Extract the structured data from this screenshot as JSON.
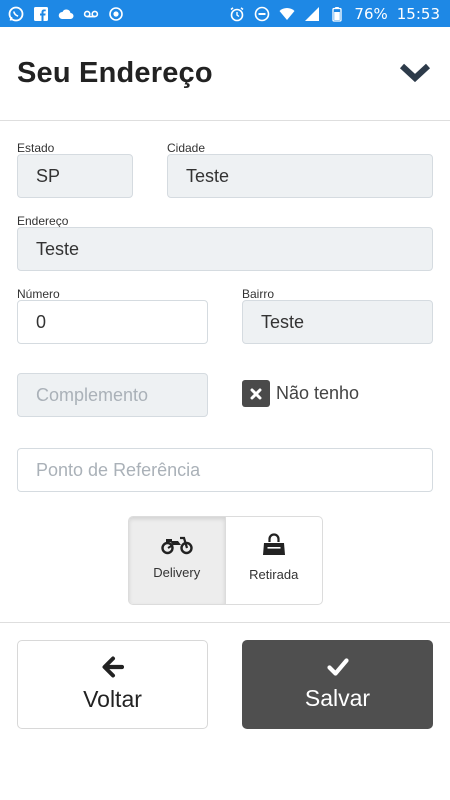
{
  "status_bar": {
    "battery": "76%",
    "time": "15:53",
    "left_icons": [
      "whatsapp-icon",
      "facebook-icon",
      "cloud-icon",
      "voicemail-icon",
      "record-icon"
    ],
    "right_icons": [
      "alarm-icon",
      "do-not-disturb-icon",
      "wifi-icon",
      "signal-icon",
      "battery-icon"
    ]
  },
  "header": {
    "title": "Seu Endereço",
    "collapse_icon": "chevron-down-icon"
  },
  "form": {
    "estado": {
      "label": "Estado",
      "value": "SP"
    },
    "cidade": {
      "label": "Cidade",
      "value": "Teste"
    },
    "endereco": {
      "label": "Endereço",
      "value": "Teste"
    },
    "numero": {
      "label": "Número",
      "value": "0"
    },
    "bairro": {
      "label": "Bairro",
      "value": "Teste"
    },
    "complemento": {
      "placeholder": "Complemento"
    },
    "nao_tenho": {
      "label": "Não tenho",
      "checked": true
    },
    "referencia": {
      "placeholder": "Ponto de Referência"
    }
  },
  "delivery_options": [
    {
      "label": "Delivery",
      "icon": "motorcycle-icon",
      "selected": true
    },
    {
      "label": "Retirada",
      "icon": "shopping-bag-icon",
      "selected": false
    }
  ],
  "actions": {
    "back": {
      "label": "Voltar",
      "icon": "arrow-left-icon"
    },
    "save": {
      "label": "Salvar",
      "icon": "check-icon"
    }
  },
  "colors": {
    "status_bar": "#1e88e5",
    "field_bg": "#eef1f3",
    "save_button": "#4f4f4f"
  }
}
